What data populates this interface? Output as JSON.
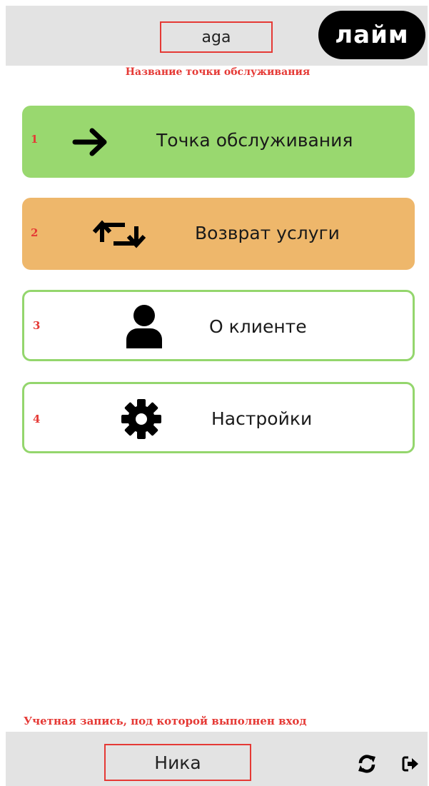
{
  "header": {
    "point_name": "aga",
    "logo_text": "лайм",
    "annotation": "Название точки обслуживания"
  },
  "menu": [
    {
      "number": "1",
      "label": "Точка обслуживания",
      "icon": "arrow-right-icon",
      "style": "filled",
      "color": "#99d86f"
    },
    {
      "number": "2",
      "label": "Возврат услуги",
      "icon": "retweet-icon",
      "style": "filled",
      "color": "#eeb76b"
    },
    {
      "number": "3",
      "label": "О клиенте",
      "icon": "user-icon",
      "style": "outlined",
      "color": "#94d66d"
    },
    {
      "number": "4",
      "label": "Настройки",
      "icon": "gear-icon",
      "style": "outlined",
      "color": "#94d66d"
    }
  ],
  "footer": {
    "annotation": "Учетная запись, под которой выполнен вход",
    "user_name": "Ника",
    "icons": [
      "refresh-icon",
      "sign-out-icon"
    ]
  },
  "colors": {
    "accent_green": "#99d86f",
    "accent_orange": "#eeb76b",
    "annotation_red": "#e53935",
    "bar_gray": "#e3e3e3"
  }
}
